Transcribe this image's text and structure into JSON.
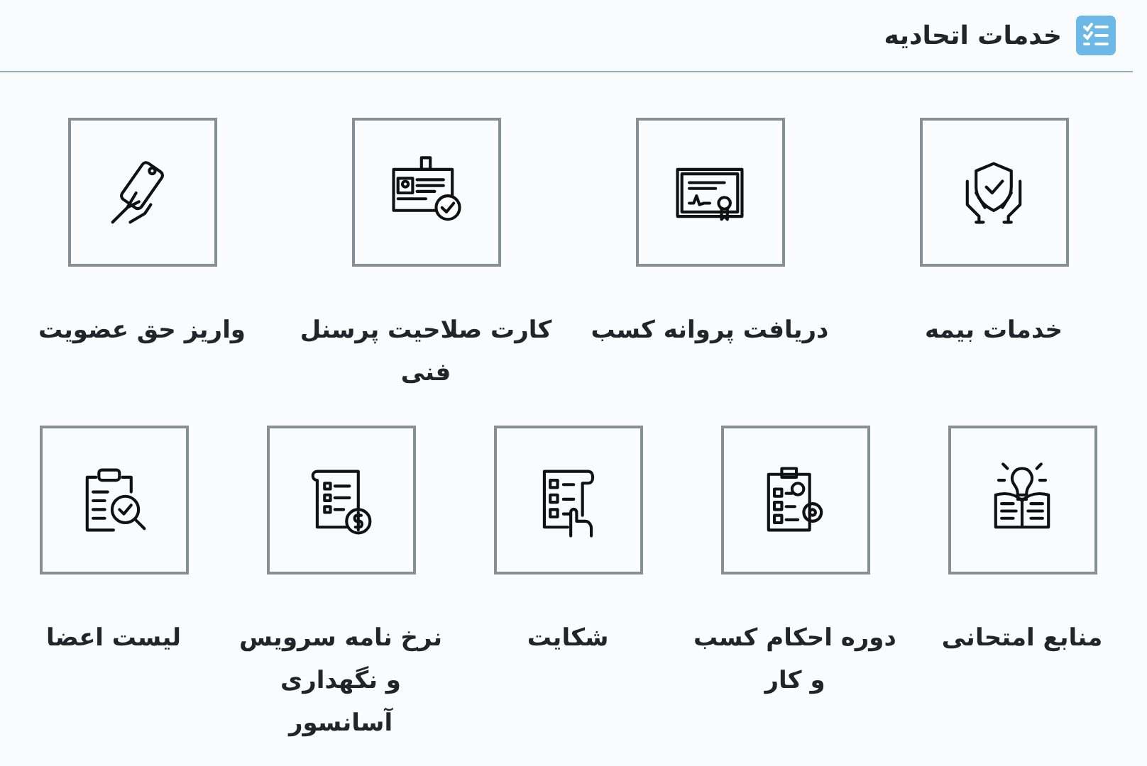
{
  "header": {
    "title": "خدمات اتحادیه"
  },
  "rows": [
    {
      "items": [
        {
          "label": "خدمات بیمه"
        },
        {
          "label": "دریافت پروانه کسب"
        },
        {
          "label": "کارت صلاحیت پرسنل فنی"
        },
        {
          "label": "واریز حق عضویت"
        }
      ]
    },
    {
      "items": [
        {
          "label": "منابع امتحانی"
        },
        {
          "label": "دوره احکام کسب و کار"
        },
        {
          "label": "شکایت"
        },
        {
          "label": "نرخ نامه سرویس و نگهداری آسانسور"
        },
        {
          "label": "لیست اعضا"
        }
      ]
    }
  ]
}
